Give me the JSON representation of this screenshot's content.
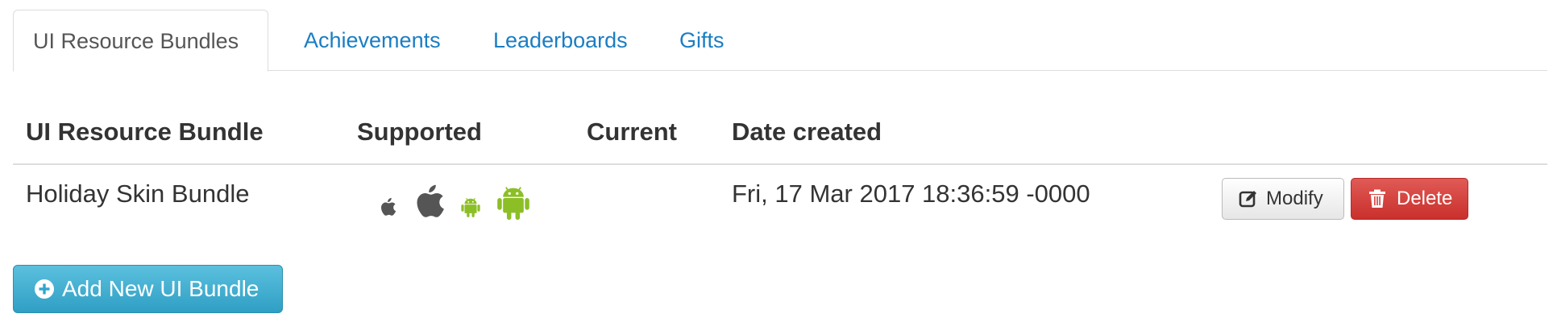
{
  "tabs": [
    {
      "label": "UI Resource Bundles",
      "active": true
    },
    {
      "label": "Achievements",
      "active": false
    },
    {
      "label": "Leaderboards",
      "active": false
    },
    {
      "label": "Gifts",
      "active": false
    }
  ],
  "table": {
    "headers": {
      "name": "UI Resource Bundle",
      "supported": "Supported",
      "current": "Current",
      "date": "Date created"
    },
    "rows": [
      {
        "name": "Holiday Skin Bundle",
        "supported_icons": [
          "apple-icon",
          "apple-icon",
          "android-icon",
          "android-icon"
        ],
        "current": "",
        "date_created": "Fri, 17 Mar 2017 18:36:59 -0000",
        "actions": {
          "modify_label": "Modify",
          "delete_label": "Delete"
        }
      }
    ]
  },
  "add_button": {
    "label": "Add New UI Bundle"
  },
  "colors": {
    "link": "#1a7ec3",
    "apple_icon": "#555555",
    "android_icon": "#8cbf26",
    "delete_button": "#d9534f",
    "add_button": "#31a6cc"
  }
}
